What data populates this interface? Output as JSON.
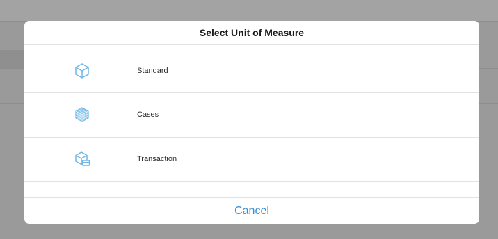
{
  "dialog": {
    "title": "Select Unit of Measure",
    "options": [
      {
        "label": "Standard",
        "icon": "single-box-icon"
      },
      {
        "label": "Cases",
        "icon": "case-stack-icon"
      },
      {
        "label": "Transaction",
        "icon": "box-with-card-icon"
      }
    ],
    "cancel_label": "Cancel"
  },
  "colors": {
    "accent": "#3a8fd6",
    "icon": "#6fb6e6",
    "overlay": "#9a9a9a"
  }
}
